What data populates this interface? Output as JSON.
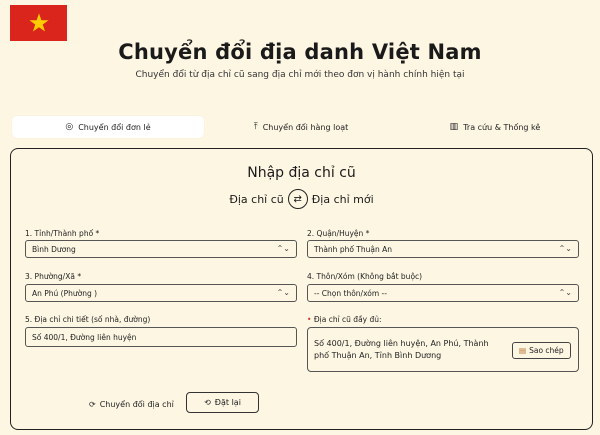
{
  "header": {
    "title": "Chuyển đổi địa danh Việt Nam",
    "subtitle": "Chuyển đổi từ địa chỉ cũ sang địa chỉ mới theo đơn vị hành chính hiện tại"
  },
  "tabs": [
    {
      "label": "Chuyển đổi đơn lẻ",
      "icon": "map-pin-icon",
      "glyph": "◎",
      "active": true
    },
    {
      "label": "Chuyển đổi hàng loạt",
      "icon": "upload-icon",
      "glyph": "⤒",
      "active": false
    },
    {
      "label": "Tra cứu & Thống kê",
      "icon": "bar-chart-icon",
      "glyph": "▥",
      "active": false
    }
  ],
  "form": {
    "heading": "Nhập địa chỉ cũ",
    "swap_left": "Địa chỉ cũ",
    "swap_right": "Địa chỉ mới",
    "swap_glyph": "⇄",
    "province_label": "1. Tỉnh/Thành phố *",
    "province_value": "Bình Dương",
    "district_label": "2. Quận/Huyện *",
    "district_value": "Thành phố Thuận An",
    "ward_label": "3. Phường/Xã *",
    "ward_value": "An Phú (Phường )",
    "hamlet_label": "4. Thôn/Xóm (Không bắt buộc)",
    "hamlet_value": "-- Chọn thôn/xóm --",
    "detail_label": "5. Địa chỉ chi tiết (số nhà, đường)",
    "detail_value": "Số 400/1, Đường liên huyện",
    "full_label": "Địa chỉ cũ đầy đủ:",
    "full_value": "Số 400/1, Đường liên huyện, An Phú, Thành phố Thuận An, Tỉnh Bình Dương",
    "copy_label": "Sao chép",
    "convert_label": "Chuyển đổi địa chỉ",
    "reset_label": "Đặt lại"
  },
  "colors": {
    "background": "#fdf6e3",
    "flag_red": "#da251d",
    "flag_star": "#ffcd00",
    "required_dot": "#d32f2f"
  }
}
